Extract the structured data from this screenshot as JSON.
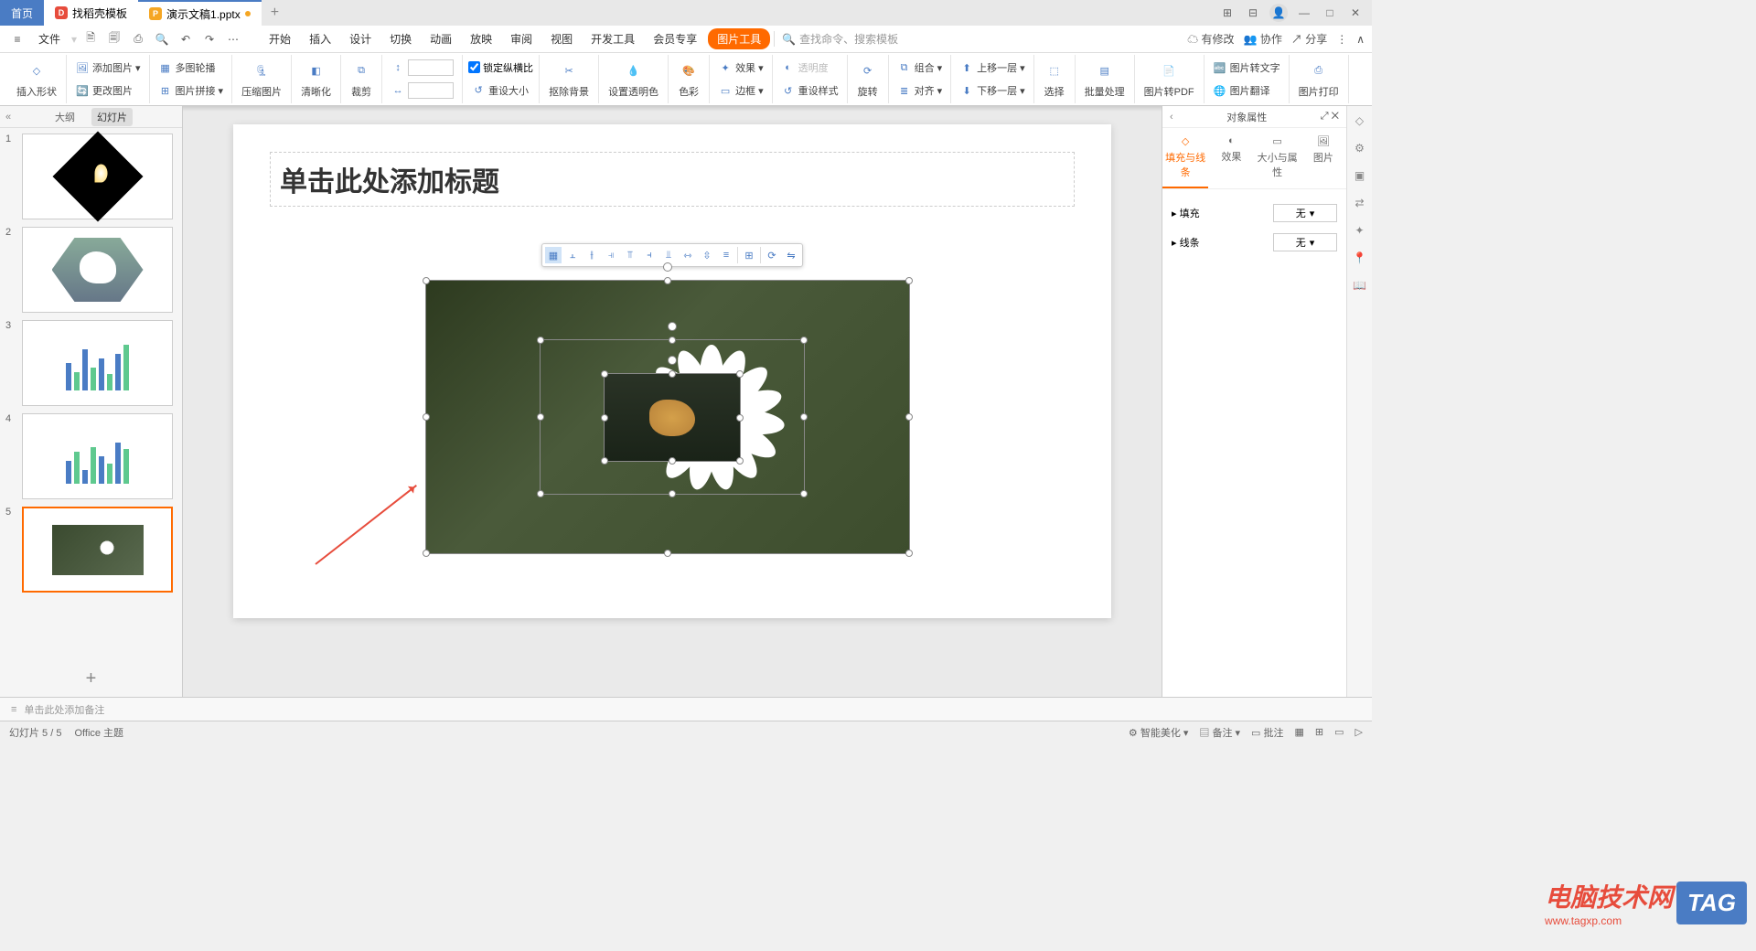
{
  "titlebar": {
    "home": "首页",
    "template_tab": "找稻壳模板",
    "doc_tab": "演示文稿1.pptx"
  },
  "quickaccess": {
    "file": "文件"
  },
  "menu": {
    "start": "开始",
    "insert": "插入",
    "design": "设计",
    "transition": "切换",
    "animation": "动画",
    "slideshow": "放映",
    "review": "审阅",
    "view": "视图",
    "dev": "开发工具",
    "member": "会员专享",
    "pictools": "图片工具"
  },
  "search": {
    "placeholder": "查找命令、搜索模板"
  },
  "menuRight": {
    "pending": "有修改",
    "coop": "协作",
    "share": "分享"
  },
  "ribbon": {
    "insertShape": "插入形状",
    "addImage": "添加图片",
    "multiCrop": "多图轮播",
    "changeImage": "更改图片",
    "imageJoin": "图片拼接",
    "compress": "压缩图片",
    "sharpen": "清晰化",
    "crop": "裁剪",
    "lockRatio": "锁定纵横比",
    "resetSize": "重设大小",
    "removeBg": "抠除背景",
    "setTransColor": "设置透明色",
    "color": "色彩",
    "effect": "效果",
    "transparency": "透明度",
    "border": "边框",
    "resetStyle": "重设样式",
    "rotate": "旋转",
    "combine": "组合",
    "align": "对齐",
    "moveUp": "上移一层",
    "moveDown": "下移一层",
    "select": "选择",
    "batch": "批量处理",
    "toPdf": "图片转PDF",
    "toText": "图片转文字",
    "translate": "图片翻译",
    "print": "图片打印",
    "widthVal": "",
    "heightVal": ""
  },
  "leftPanel": {
    "outline": "大纲",
    "slides": "幻灯片",
    "nums": [
      "1",
      "2",
      "3",
      "4",
      "5"
    ]
  },
  "canvas": {
    "titlePlaceholder": "单击此处添加标题"
  },
  "rightPanel": {
    "header": "对象属性",
    "tabs": {
      "fill": "填充与线条",
      "effect": "效果",
      "size": "大小与属性",
      "picture": "图片"
    },
    "fillLabel": "填充",
    "lineLabel": "线条",
    "none": "无"
  },
  "notes": {
    "placeholder": "单击此处添加备注"
  },
  "status": {
    "slideInfo": "幻灯片 5 / 5",
    "theme": "Office 主题",
    "beautify": "智能美化",
    "notes": "备注",
    "batch": "批注"
  },
  "watermark": {
    "text": "电脑技术网",
    "url": "www.tagxp.com",
    "tag": "TAG"
  }
}
